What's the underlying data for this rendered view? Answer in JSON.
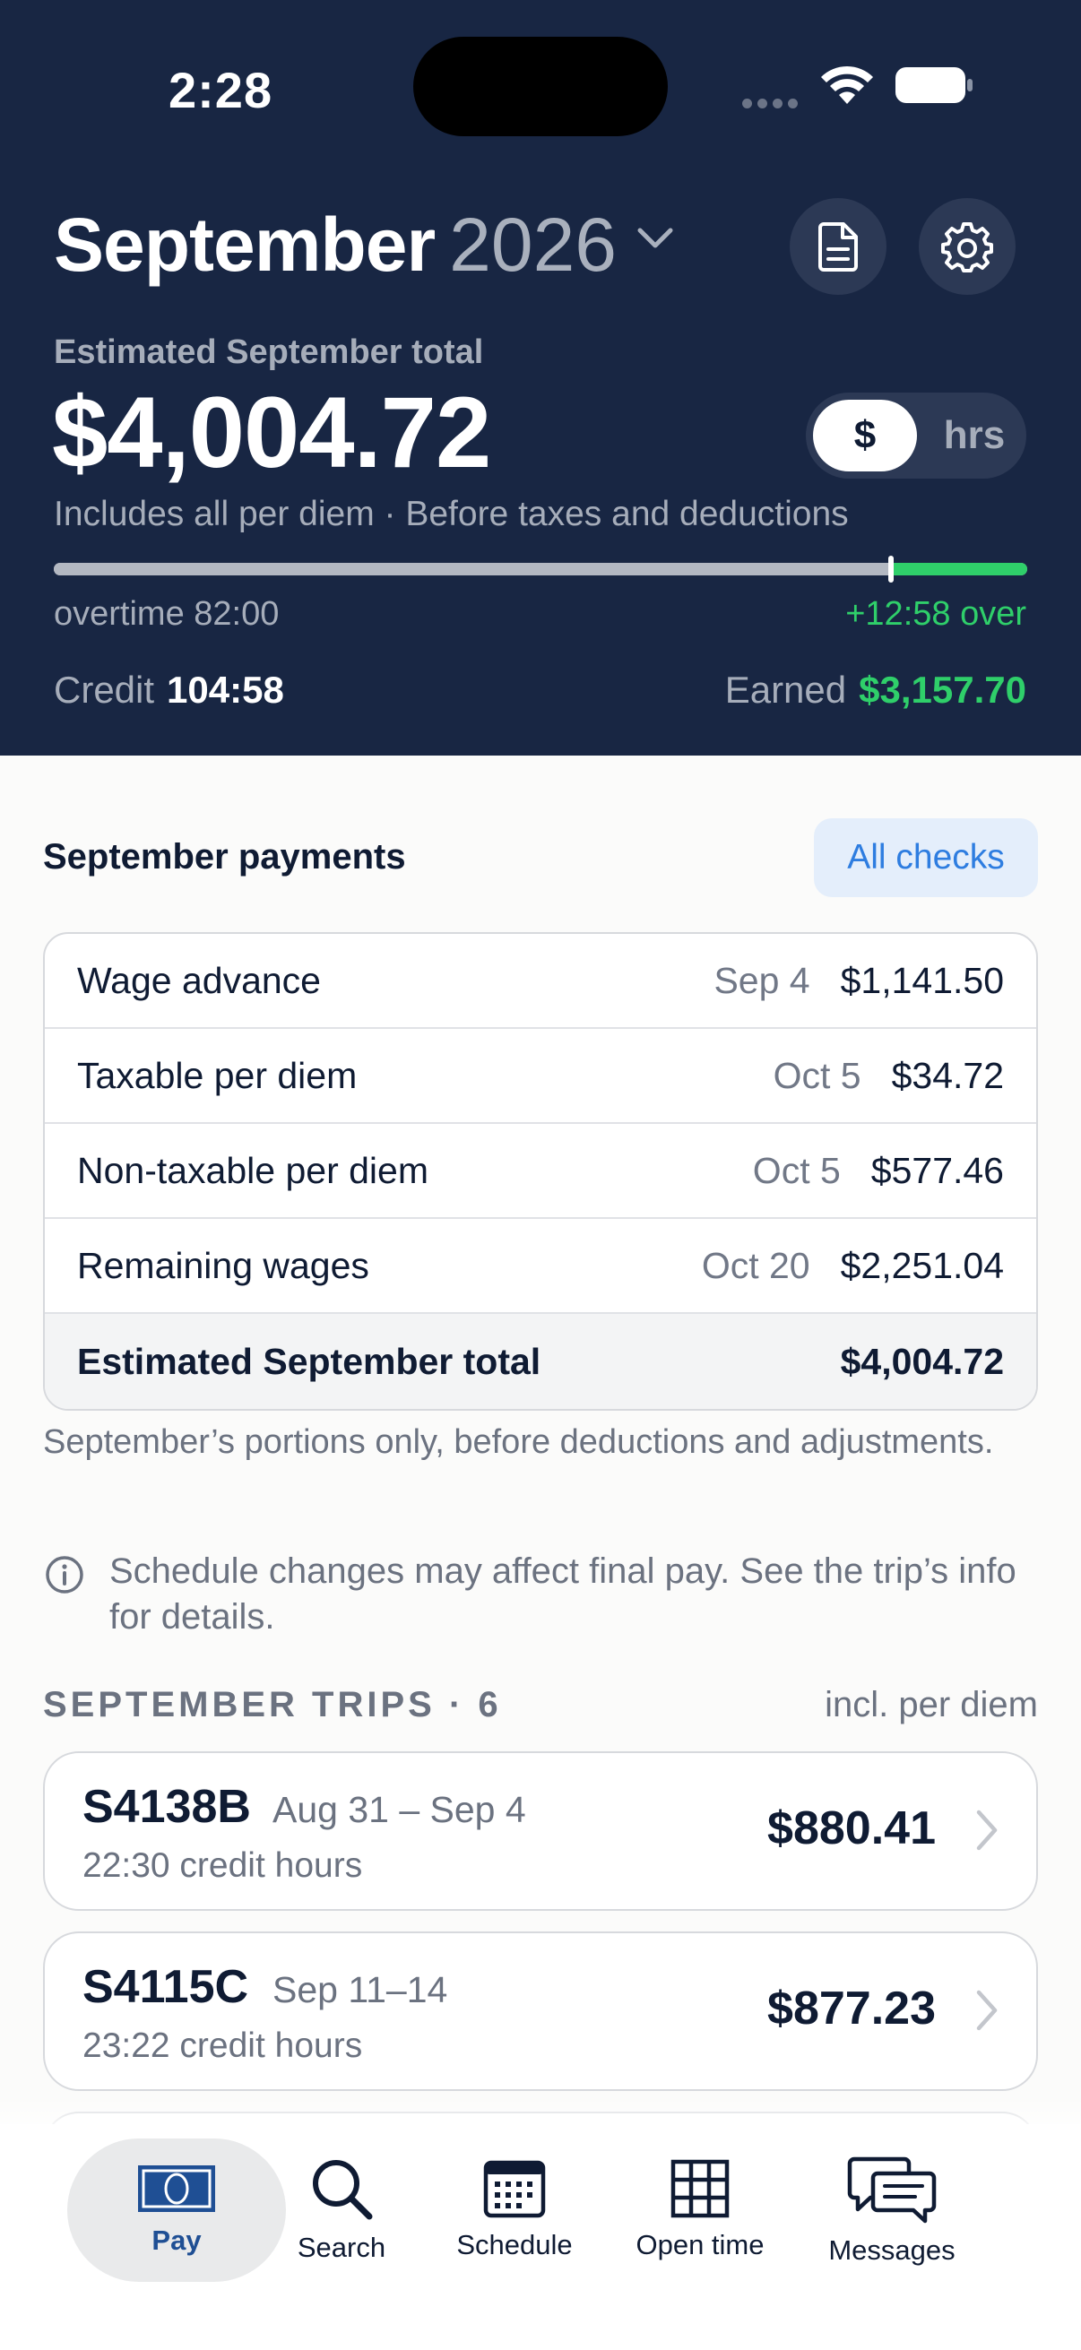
{
  "status": {
    "time": "2:28"
  },
  "header": {
    "month": "September",
    "year": "2026",
    "estimate_label": "Estimated September total",
    "estimate_amount": "$4,004.72",
    "toggle": {
      "active": "$",
      "inactive": "hrs"
    },
    "note": "Includes all per diem · Before taxes and deductions",
    "progress": {
      "threshold_fraction": 0.86,
      "over_fraction": 0.14
    },
    "overtime_label": "overtime 82:00",
    "over_label": "+12:58 over",
    "credit_label": "Credit",
    "credit_value": "104:58",
    "earned_label": "Earned",
    "earned_value": "$3,157.70"
  },
  "payments": {
    "title": "September payments",
    "all_checks": "All checks",
    "rows": [
      {
        "name": "Wage advance",
        "date": "Sep 4",
        "amount": "$1,141.50"
      },
      {
        "name": "Taxable per diem",
        "date": "Oct 5",
        "amount": "$34.72"
      },
      {
        "name": "Non-taxable per diem",
        "date": "Oct 5",
        "amount": "$577.46"
      },
      {
        "name": "Remaining wages",
        "date": "Oct 20",
        "amount": "$2,251.04"
      }
    ],
    "total_label": "Estimated September total",
    "total_amount": "$4,004.72",
    "portion_note": "September’s portions only, before deductions and adjustments.",
    "info_note": "Schedule changes may affect final pay. See the trip’s info for details."
  },
  "trips": {
    "heading": "SEPTEMBER TRIPS · 6",
    "right_label": "incl. per diem",
    "items": [
      {
        "id": "S4138B",
        "dates": "Aug 31 – Sep 4",
        "credit": "22:30 credit hours",
        "amount": "$880.41"
      },
      {
        "id": "S4115C",
        "dates": "Sep 11–14",
        "credit": "23:22 credit hours",
        "amount": "$877.23"
      }
    ]
  },
  "tabs": [
    {
      "label": "Pay",
      "icon": "banknote-icon",
      "active": true
    },
    {
      "label": "Search",
      "icon": "search-icon",
      "active": false
    },
    {
      "label": "Schedule",
      "icon": "calendar-icon",
      "active": false
    },
    {
      "label": "Open time",
      "icon": "grid-icon",
      "active": false
    },
    {
      "label": "Messages",
      "icon": "chat-bubbles-icon",
      "active": false
    }
  ],
  "colors": {
    "header_bg": "#182643",
    "accent_green": "#2fcf6a",
    "link_blue": "#2e7de0",
    "active_tab": "#1f4f94"
  }
}
